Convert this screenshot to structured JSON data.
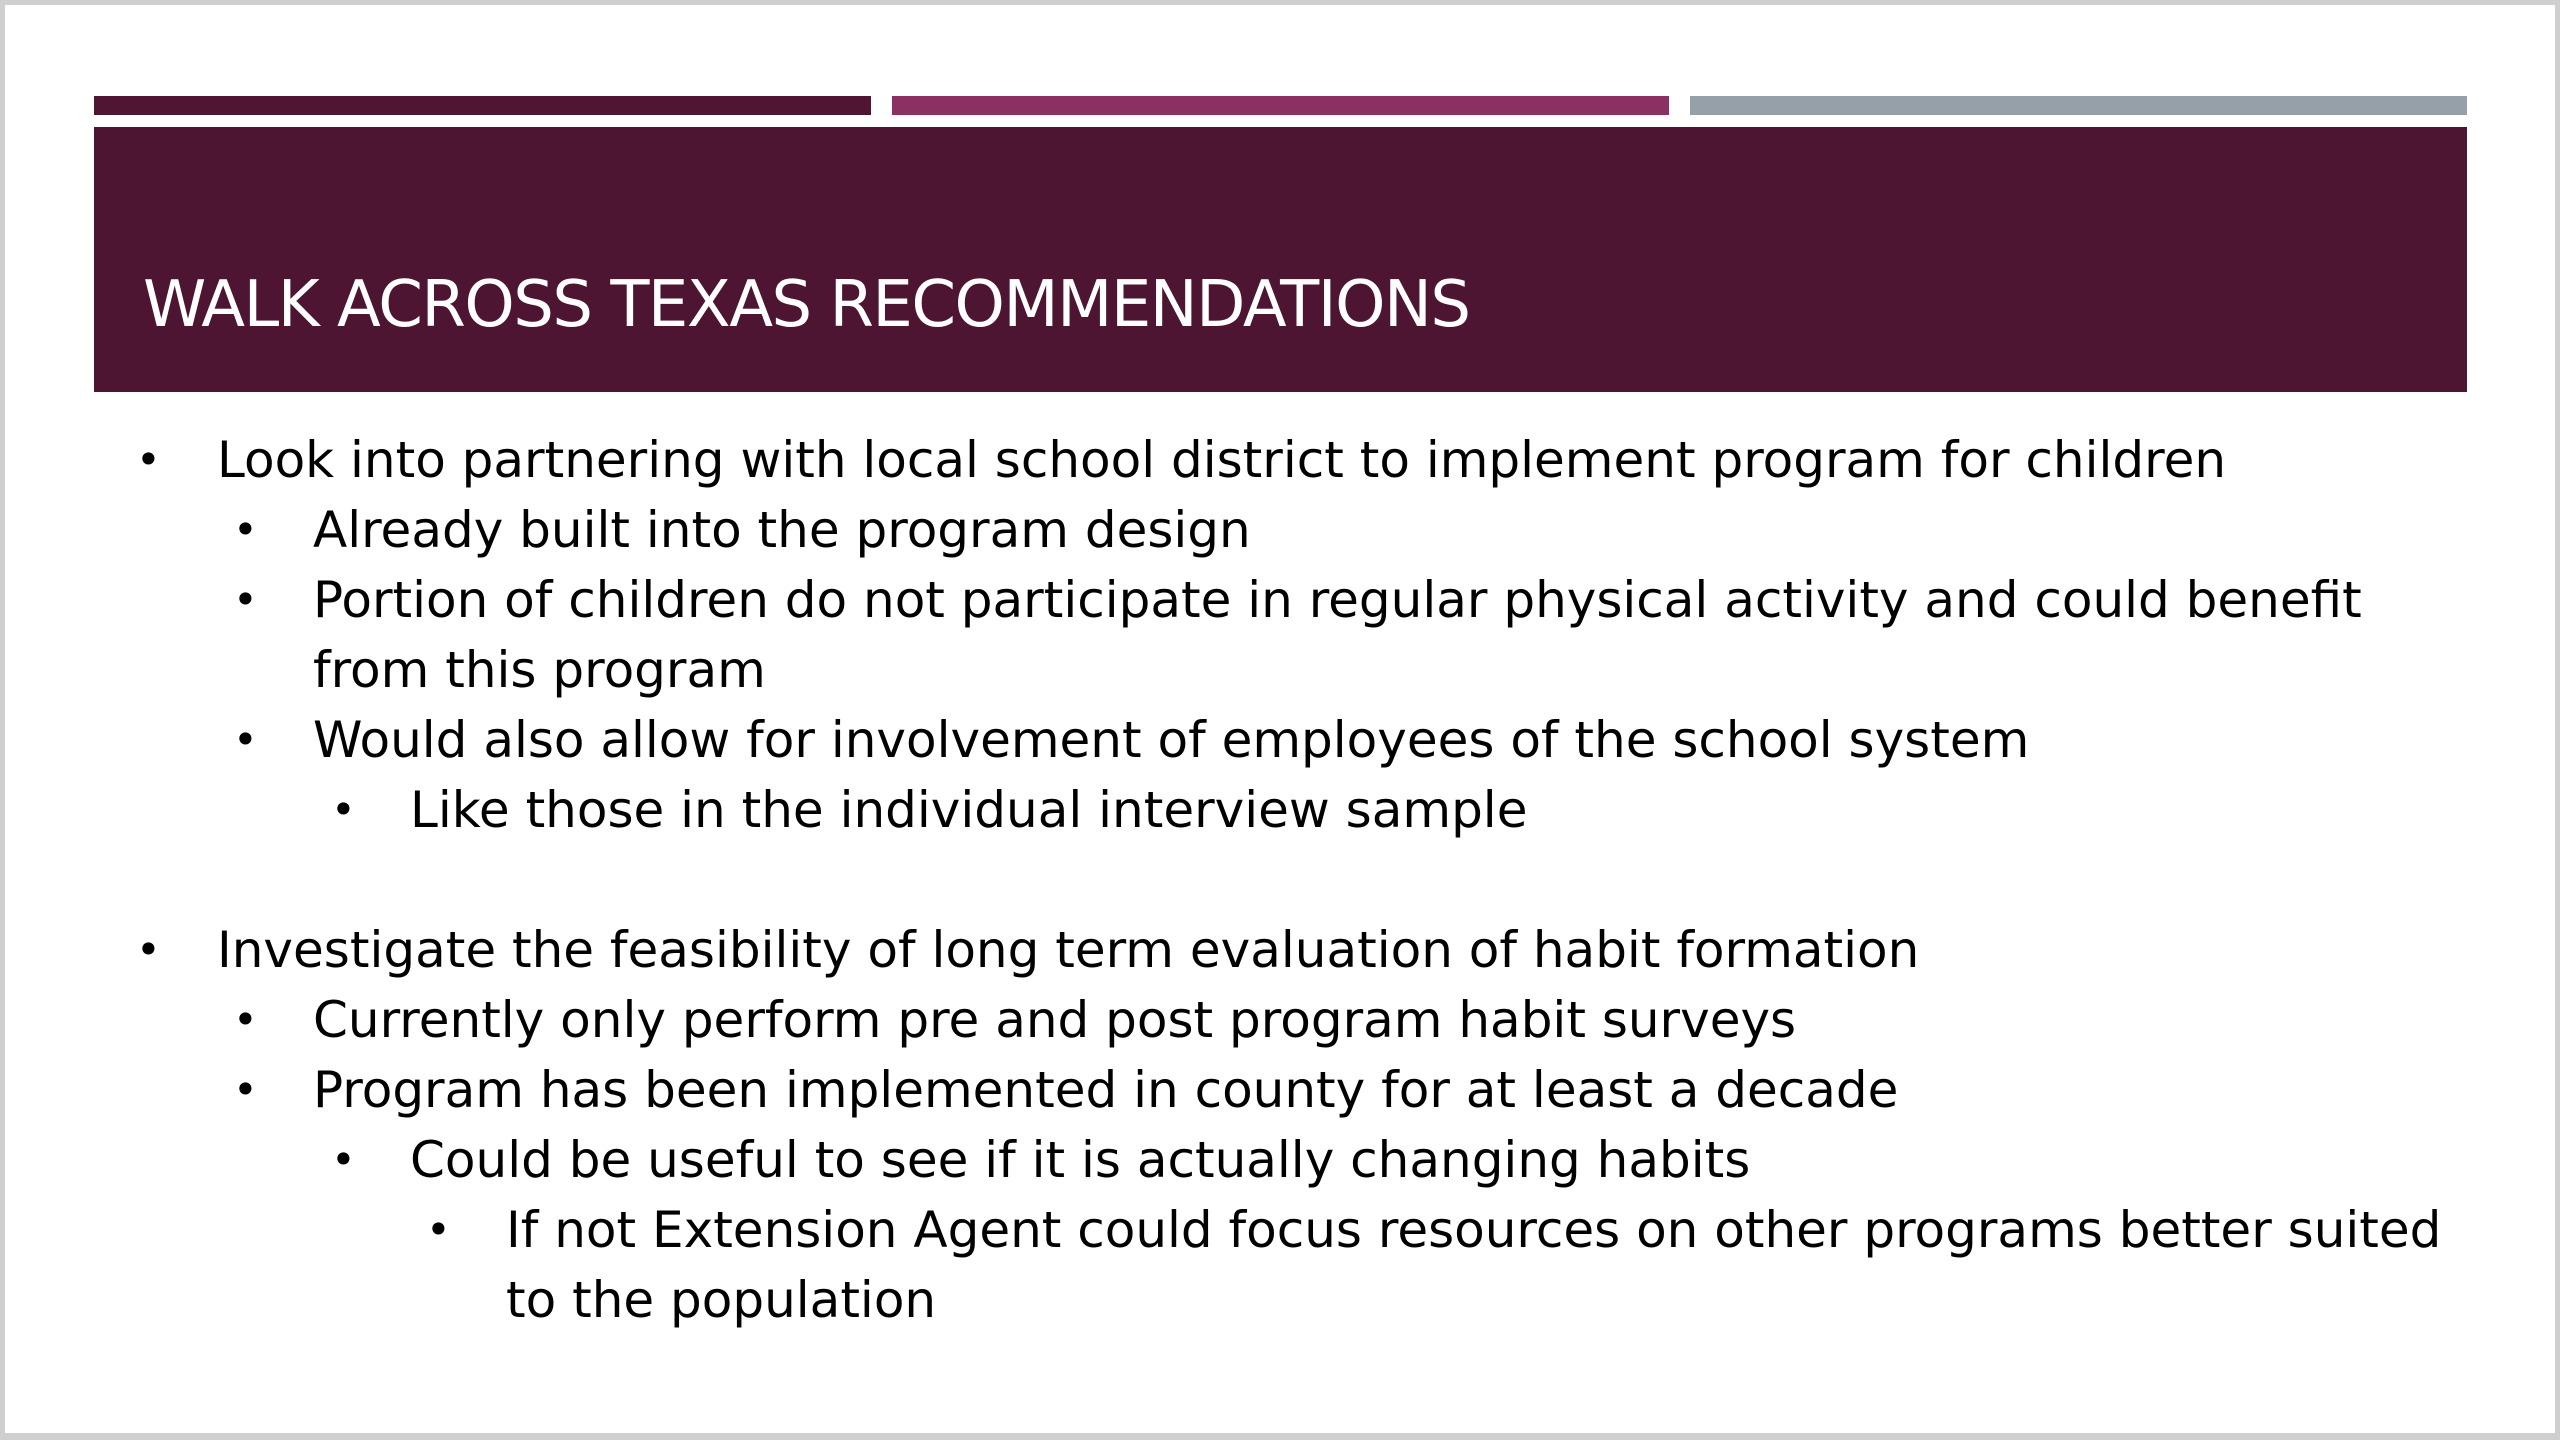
{
  "slide": {
    "title": "WALK ACROSS TEXAS RECOMMENDATIONS",
    "bullet_glyph": "•",
    "colors": {
      "title_band": "#4e1533",
      "accent_1": "#4f1533",
      "accent_2": "#8c2f62",
      "accent_3": "#96a0a9"
    },
    "bullets": [
      "Look into partnering with local school district to implement program for children",
      "Already built into the program design",
      "Portion of children do not participate in regular physical activity and could benefit from this program",
      "Would also allow for involvement of employees of the school system",
      "Like those in the individual interview sample",
      "Investigate the feasibility of long term evaluation of habit formation",
      "Currently only perform pre and post program habit surveys",
      "Program has been implemented in county for at least a decade",
      "Could be useful to see if it is actually changing habits",
      "If not Extension Agent could focus resources on other programs better suited to the population"
    ]
  }
}
